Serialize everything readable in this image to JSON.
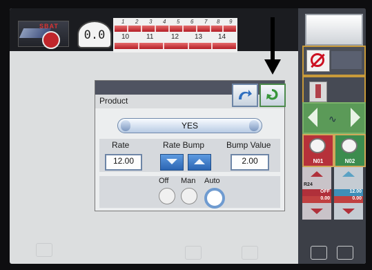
{
  "gauge": {
    "value": "0.0"
  },
  "sections": {
    "top_numbers": [
      "1",
      "2",
      "3",
      "4",
      "5",
      "6",
      "7",
      "8",
      "9"
    ],
    "bottom_numbers": [
      "10",
      "11",
      "12",
      "13",
      "14"
    ]
  },
  "right_panel": {
    "n01": "N01",
    "n02": "N02",
    "r24": "R24",
    "left_chip_1": "OFF",
    "left_chip_2": "0.00",
    "right_chip_1": "12.00",
    "right_chip_2": "0.00"
  },
  "dialog": {
    "title": "Product",
    "selector_value": "YES",
    "rate_label": "Rate",
    "rate_bump_label": "Rate Bump",
    "bump_value_label": "Bump Value",
    "rate_value": "12.00",
    "bump_value": "2.00",
    "modes": [
      "Off",
      "Man",
      "Auto"
    ],
    "selected_mode": "Auto"
  },
  "colors": {
    "accent_blue": "#6d85a6",
    "accent_red": "#b41e26",
    "accent_green": "#4c8a4c"
  }
}
